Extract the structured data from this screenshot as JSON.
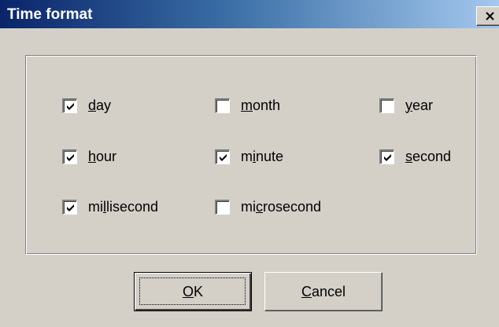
{
  "dialog": {
    "title": "Time format",
    "close_label": "×"
  },
  "checkboxes": [
    {
      "label_before": "",
      "mnemonic": "d",
      "label_after": "ay",
      "checked": true
    },
    {
      "label_before": "",
      "mnemonic": "m",
      "label_after": "onth",
      "checked": false
    },
    {
      "label_before": "",
      "mnemonic": "y",
      "label_after": "ear",
      "checked": false
    },
    {
      "label_before": "",
      "mnemonic": "h",
      "label_after": "our",
      "checked": true
    },
    {
      "label_before": "m",
      "mnemonic": "i",
      "label_after": "nute",
      "checked": true
    },
    {
      "label_before": "",
      "mnemonic": "s",
      "label_after": "econd",
      "checked": true
    },
    {
      "label_before": "mi",
      "mnemonic": "l",
      "label_after": "lisecond",
      "checked": true
    },
    {
      "label_before": "mi",
      "mnemonic": "c",
      "label_after": "rosecond",
      "checked": false
    }
  ],
  "buttons": {
    "ok": {
      "mnemonic": "O",
      "rest": "K"
    },
    "cancel": {
      "mnemonic": "C",
      "rest": "ancel"
    }
  }
}
